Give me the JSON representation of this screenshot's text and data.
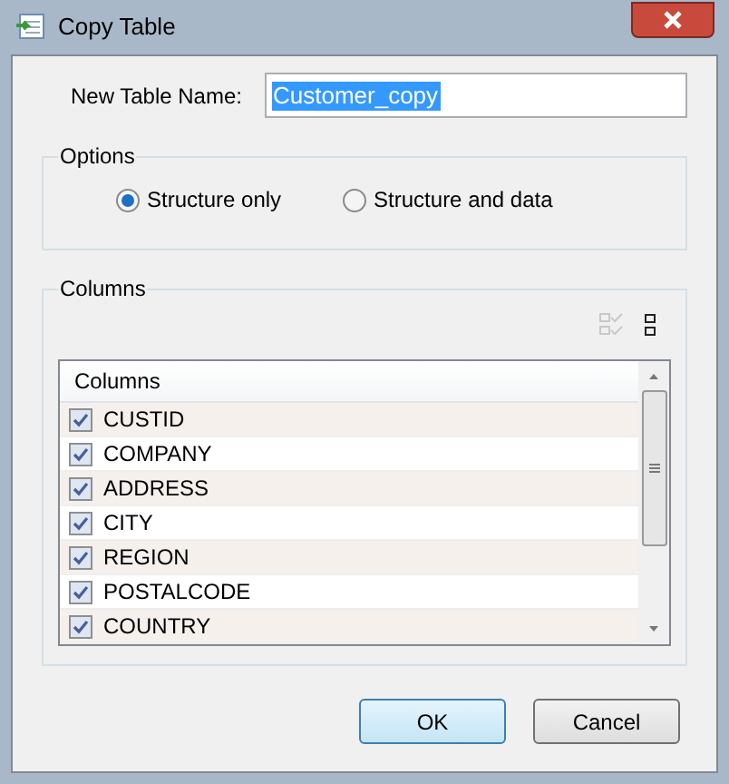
{
  "window": {
    "title": "Copy Table"
  },
  "name_field": {
    "label": "New Table Name:",
    "value": "Customer_copy"
  },
  "options": {
    "title": "Options",
    "radios": [
      {
        "label": "Structure only",
        "selected": true
      },
      {
        "label": "Structure and data",
        "selected": false
      }
    ]
  },
  "columns": {
    "title": "Columns",
    "header": "Columns",
    "rows": [
      {
        "name": "CUSTID",
        "checked": true
      },
      {
        "name": "COMPANY",
        "checked": true
      },
      {
        "name": "ADDRESS",
        "checked": true
      },
      {
        "name": "CITY",
        "checked": true
      },
      {
        "name": "REGION",
        "checked": true
      },
      {
        "name": "POSTALCODE",
        "checked": true
      },
      {
        "name": "COUNTRY",
        "checked": true
      }
    ]
  },
  "buttons": [
    {
      "label": "OK",
      "default": true
    },
    {
      "label": "Cancel",
      "default": false
    }
  ]
}
